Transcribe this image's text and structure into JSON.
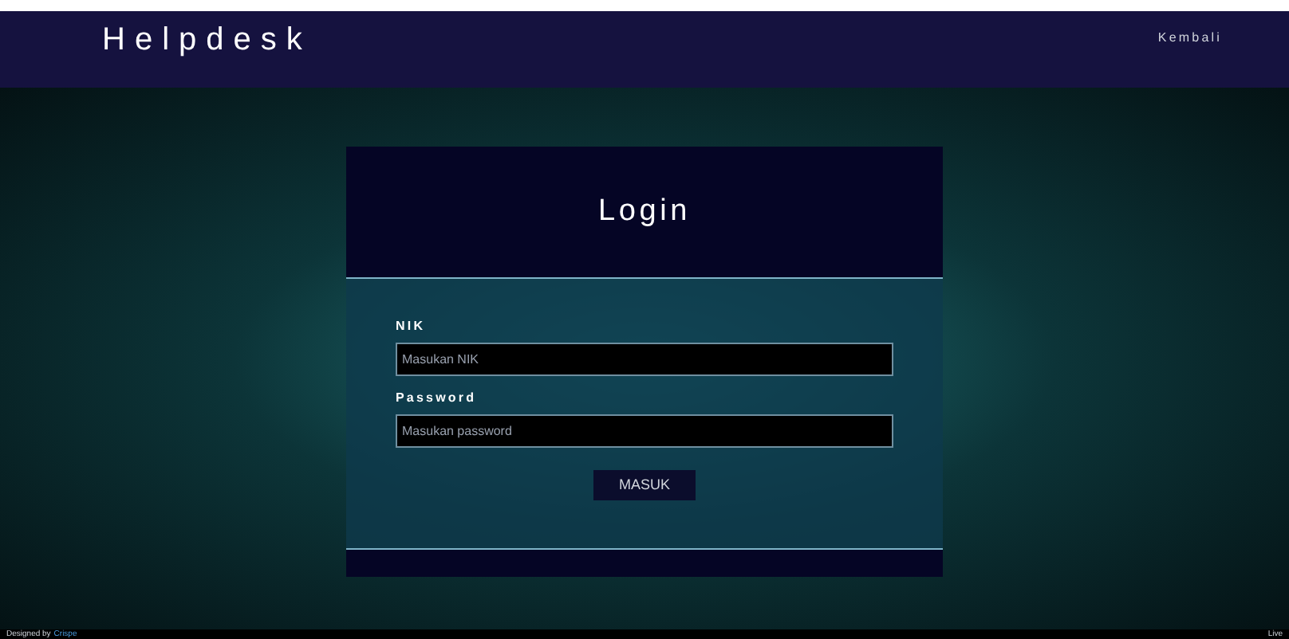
{
  "header": {
    "title": "Helpdesk",
    "link": "Kembali"
  },
  "login": {
    "title": "Login",
    "fields": [
      {
        "label": "NIK",
        "placeholder": "Masukan NIK"
      },
      {
        "label": "Password",
        "placeholder": "Masukan password"
      }
    ],
    "button": "MASUK"
  },
  "footer": {
    "text": "Designed by",
    "link": "Crispe",
    "right": "Live"
  }
}
